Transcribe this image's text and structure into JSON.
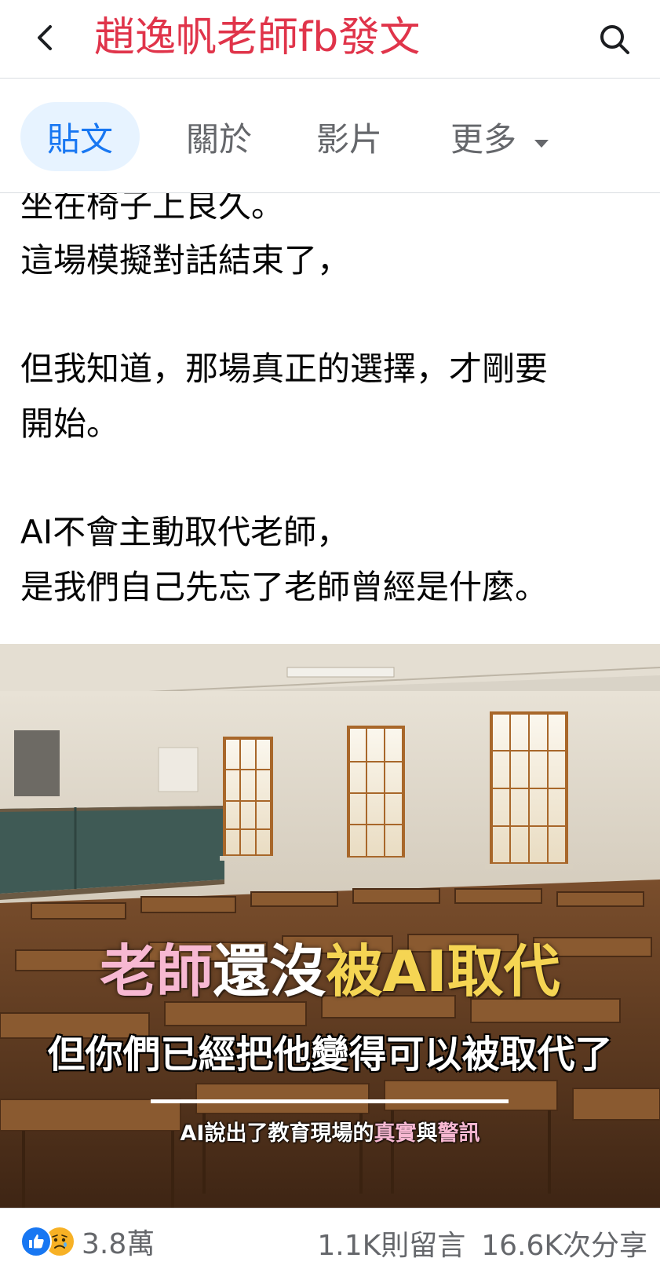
{
  "header": {
    "title": "趙逸帆老師fb發文",
    "back_icon": "chevron-left-icon",
    "search_icon": "search-icon"
  },
  "tabs": [
    {
      "label": "貼文",
      "active": true
    },
    {
      "label": "關於",
      "active": false
    },
    {
      "label": "影片",
      "active": false
    },
    {
      "label": "更多",
      "active": false
    }
  ],
  "post": {
    "lines": [
      "坐在椅子上良久。",
      "這場模擬對話結束了，",
      "但我知道，那場真正的選擇，才剛要",
      "開始。",
      "AI不會主動取代老師，",
      "是我們自己先忘了老師曾經是什麼。"
    ],
    "image": {
      "title_part1": "老師",
      "title_part2": "還沒",
      "title_part3": "被AI取代",
      "subtitle": "但你們已經把他變得可以被取代了",
      "caption_part1": "AI說出了教育現場的",
      "caption_part2": "真實",
      "caption_part3": "與",
      "caption_part4": "警訊"
    }
  },
  "footer": {
    "reaction_count": "3.8萬",
    "comments": "1.1K則留言",
    "shares": "16.6K次分享"
  },
  "colors": {
    "title_red": "#e0344a",
    "facebook_blue": "#1877f2",
    "tab_active_bg": "#e7f3ff",
    "pink": "#f7b8d2",
    "yellow": "#f5d553"
  }
}
